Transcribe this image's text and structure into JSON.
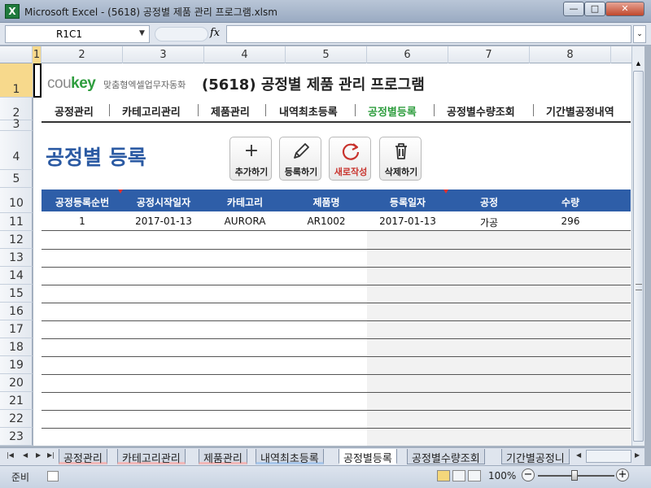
{
  "window": {
    "title": "Microsoft Excel - (5618) 공정별 제품 관리 프로그램.xlsm",
    "app_icon": "X",
    "minimize": "—",
    "maximize": "□",
    "close": "✕"
  },
  "formula_bar": {
    "name_box": "R1C1",
    "fx_label": "fx",
    "formula": ""
  },
  "columns": [
    "1",
    "2",
    "3",
    "4",
    "5",
    "6",
    "7",
    "8"
  ],
  "rows": [
    "1",
    "2",
    "3",
    "4",
    "5",
    "10",
    "11",
    "12",
    "13",
    "14",
    "15",
    "16",
    "17",
    "18",
    "19",
    "20",
    "21",
    "22",
    "23"
  ],
  "header": {
    "logo_brand_prefix": "cou",
    "logo_brand_suffix": "key",
    "logo_tagline": "맞춤형엑셀업무자동화",
    "program_title": "(5618) 공정별 제품 관리 프로그램"
  },
  "menu": [
    "공정관리",
    "카테고리관리",
    "제품관리",
    "내역최초등록",
    "공정별등록",
    "공정별수량조회",
    "기간별공정내역"
  ],
  "menu_active_color": "#2e9d3e",
  "section_title": "공정별 등록",
  "toolbar": {
    "add": {
      "label": "추가하기",
      "icon": "plus-icon"
    },
    "register": {
      "label": "등록하기",
      "icon": "pencil-icon"
    },
    "new": {
      "label": "새로작성",
      "icon": "refresh-icon"
    },
    "delete": {
      "label": "삭제하기",
      "icon": "trash-icon"
    }
  },
  "table": {
    "headers": [
      "공정등록순번",
      "공정시작일자",
      "카테고리",
      "제품명",
      "등록일자",
      "공정",
      "수량"
    ],
    "rows": [
      [
        "1",
        "2017-01-13",
        "AURORA",
        "AR1002",
        "2017-01-13",
        "가공",
        "296"
      ]
    ]
  },
  "sheet_tabs": [
    "공정관리",
    "카테고리관리",
    "제품관리",
    "내역최초등록",
    "공정별등록",
    "공정별수량조회",
    "기간별공정니"
  ],
  "active_tab": "공정별등록",
  "status": {
    "mode": "준비",
    "zoom": "100%"
  }
}
